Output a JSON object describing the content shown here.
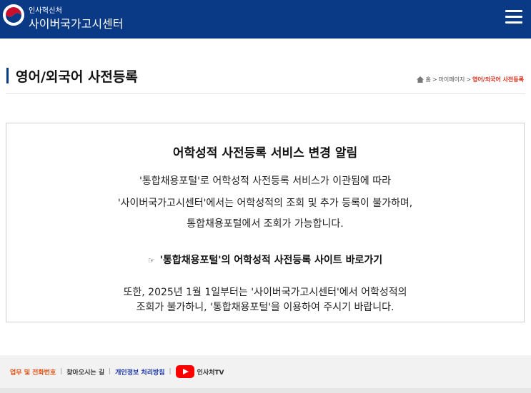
{
  "header": {
    "org_small": "인사혁신처",
    "org_big": "사이버국가고시센터",
    "menu_icon": "hamburger-menu-icon",
    "logo": "korea-government-emblem"
  },
  "page": {
    "title": "영어/외국어 사전등록",
    "breadcrumb": {
      "home_icon": "home-icon",
      "home": "홈",
      "sep": ">",
      "mypage": "마이페이지",
      "current": "영어/외국어 사전등록"
    }
  },
  "notice": {
    "title": "어학성적 사전등록 서비스 변경 알림",
    "line1": "'통합채용포털'로 어학성적 사전등록 서비스가 이관됨에 따라",
    "line2": "'사이버국가고시센터'에서는 어학성적의 조회 및 추가 등록이 불가하며,",
    "line3": "통합채용포털에서 조회가 가능합니다.",
    "link_icon": "☞",
    "link_text": "'통합채용포털'의 어학성적 사전등록 사이트 바로가기",
    "line4": "또한, 2025년 1월 1일부터는 '사이버국가고시센터'에서 어학성적의",
    "line5": "조회가 불가하니, '통합채용포털'을 이용하여 주시기 바랍니다."
  },
  "footer": {
    "links": [
      {
        "label": "업무 및 전화번호"
      },
      {
        "label": "찾아오시는 길"
      },
      {
        "label": "개인정보 처리방침"
      },
      {
        "label": "인사처TV"
      }
    ],
    "sep": "|",
    "youtube_icon": "youtube-icon"
  },
  "colors": {
    "header_bg": "#0a3a86",
    "breadcrumb_current": "#d9301c",
    "footer_orange": "#e04f12",
    "footer_blue": "#1a35a8",
    "youtube_red": "#ff0000"
  }
}
